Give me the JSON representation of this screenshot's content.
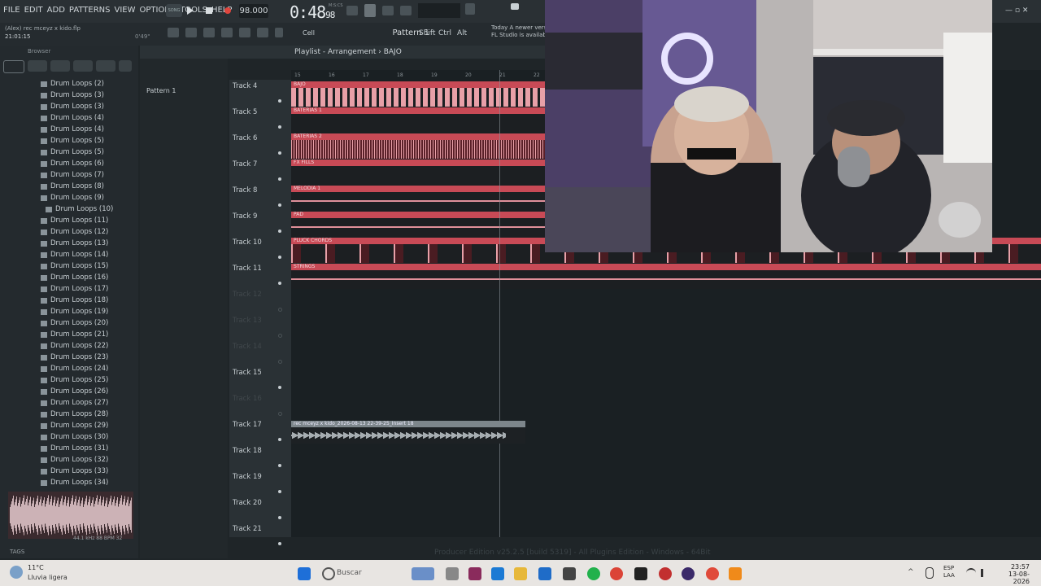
{
  "menu": [
    "FILE",
    "EDIT",
    "ADD",
    "PATTERNS",
    "VIEW",
    "OPTIONS",
    "TOOLS",
    "HELP"
  ],
  "transport": {
    "song_label": "SONG",
    "tempo": "98.000",
    "time_main": "0:48",
    "time_sub": "98",
    "time_unit": "M:S:CS"
  },
  "project": {
    "title": "(Alex) rec mceyz x kido.flp",
    "time": "21:01:15",
    "hint_time": "0'49\""
  },
  "toolbar": {
    "cell": "Cell",
    "pattern": "Pattern 1",
    "shift": "Shift",
    "ctrl": "Ctrl",
    "alt": "Alt"
  },
  "news": {
    "line1": "Today   A newer vers",
    "line2": "FL Studio is available"
  },
  "browser": {
    "title": "Browser",
    "items": [
      "Drum Loops  (2)",
      "Drum Loops  (3)",
      "Drum Loops  (3)",
      "Drum Loops  (4)",
      "Drum Loops  (4)",
      "Drum Loops  (5)",
      "Drum Loops  (5)",
      "Drum Loops  (6)",
      "Drum Loops  (7)",
      "Drum Loops  (8)",
      "Drum Loops  (9)",
      "Drum Loops  (10)",
      "Drum Loops  (11)",
      "Drum Loops  (12)",
      "Drum Loops  (13)",
      "Drum Loops  (14)",
      "Drum Loops  (15)",
      "Drum Loops  (16)",
      "Drum Loops  (17)",
      "Drum Loops  (18)",
      "Drum Loops  (19)",
      "Drum Loops  (20)",
      "Drum Loops  (21)",
      "Drum Loops  (22)",
      "Drum Loops  (23)",
      "Drum Loops  (24)",
      "Drum Loops  (25)",
      "Drum Loops  (26)",
      "Drum Loops  (27)",
      "Drum Loops  (28)",
      "Drum Loops  (29)",
      "Drum Loops  (30)",
      "Drum Loops  (31)",
      "Drum Loops  (32)",
      "Drum Loops  (33)",
      "Drum Loops  (34)"
    ],
    "wave_info": "44.1 kHz 88 BPM 32",
    "tags": "TAGS"
  },
  "pattern_list": [
    "Pattern 1"
  ],
  "playlist": {
    "title": "Playlist - Arrangement",
    "current": "BAJO",
    "ruler": [
      "15",
      "16",
      "17",
      "18",
      "19",
      "20",
      "21",
      "22"
    ],
    "tracks": [
      {
        "label": "Track 4",
        "clip": "BAJO"
      },
      {
        "label": "Track 5",
        "clip": "BATERIAS 1"
      },
      {
        "label": "Track 6",
        "clip": "BATERIAS 2"
      },
      {
        "label": "Track 7",
        "clip": "FX FILLS"
      },
      {
        "label": "Track 8",
        "clip": "MELODIA 1"
      },
      {
        "label": "Track 9",
        "clip": "PAD"
      },
      {
        "label": "Track 10",
        "clip": "PLUCK CHORDS"
      },
      {
        "label": "Track 11",
        "clip": "STRINGS"
      },
      {
        "label": "Track 12",
        "clip": ""
      },
      {
        "label": "Track 13",
        "clip": ""
      },
      {
        "label": "Track 14",
        "clip": ""
      },
      {
        "label": "Track 15",
        "clip": ""
      },
      {
        "label": "Track 16",
        "clip": ""
      },
      {
        "label": "Track 17",
        "clip": "rec mceyz x kido_2026-08-13 22-39-25_Insert 18"
      },
      {
        "label": "Track 18",
        "clip": ""
      },
      {
        "label": "Track 19",
        "clip": ""
      },
      {
        "label": "Track 20",
        "clip": ""
      },
      {
        "label": "Track 21",
        "clip": ""
      }
    ]
  },
  "status": "Producer Edition v25.2.5 [build 5319] - All Plugins Edition - Windows - 64Bit",
  "taskbar": {
    "temp": "11°C",
    "weather": "Lluvia ligera",
    "search": "Buscar",
    "lang1": "ESP",
    "lang2": "LAA",
    "time": "23:57",
    "date": "13-08-2026"
  },
  "colors": {
    "clip": "#c84a56",
    "bg": "#1f2528"
  }
}
